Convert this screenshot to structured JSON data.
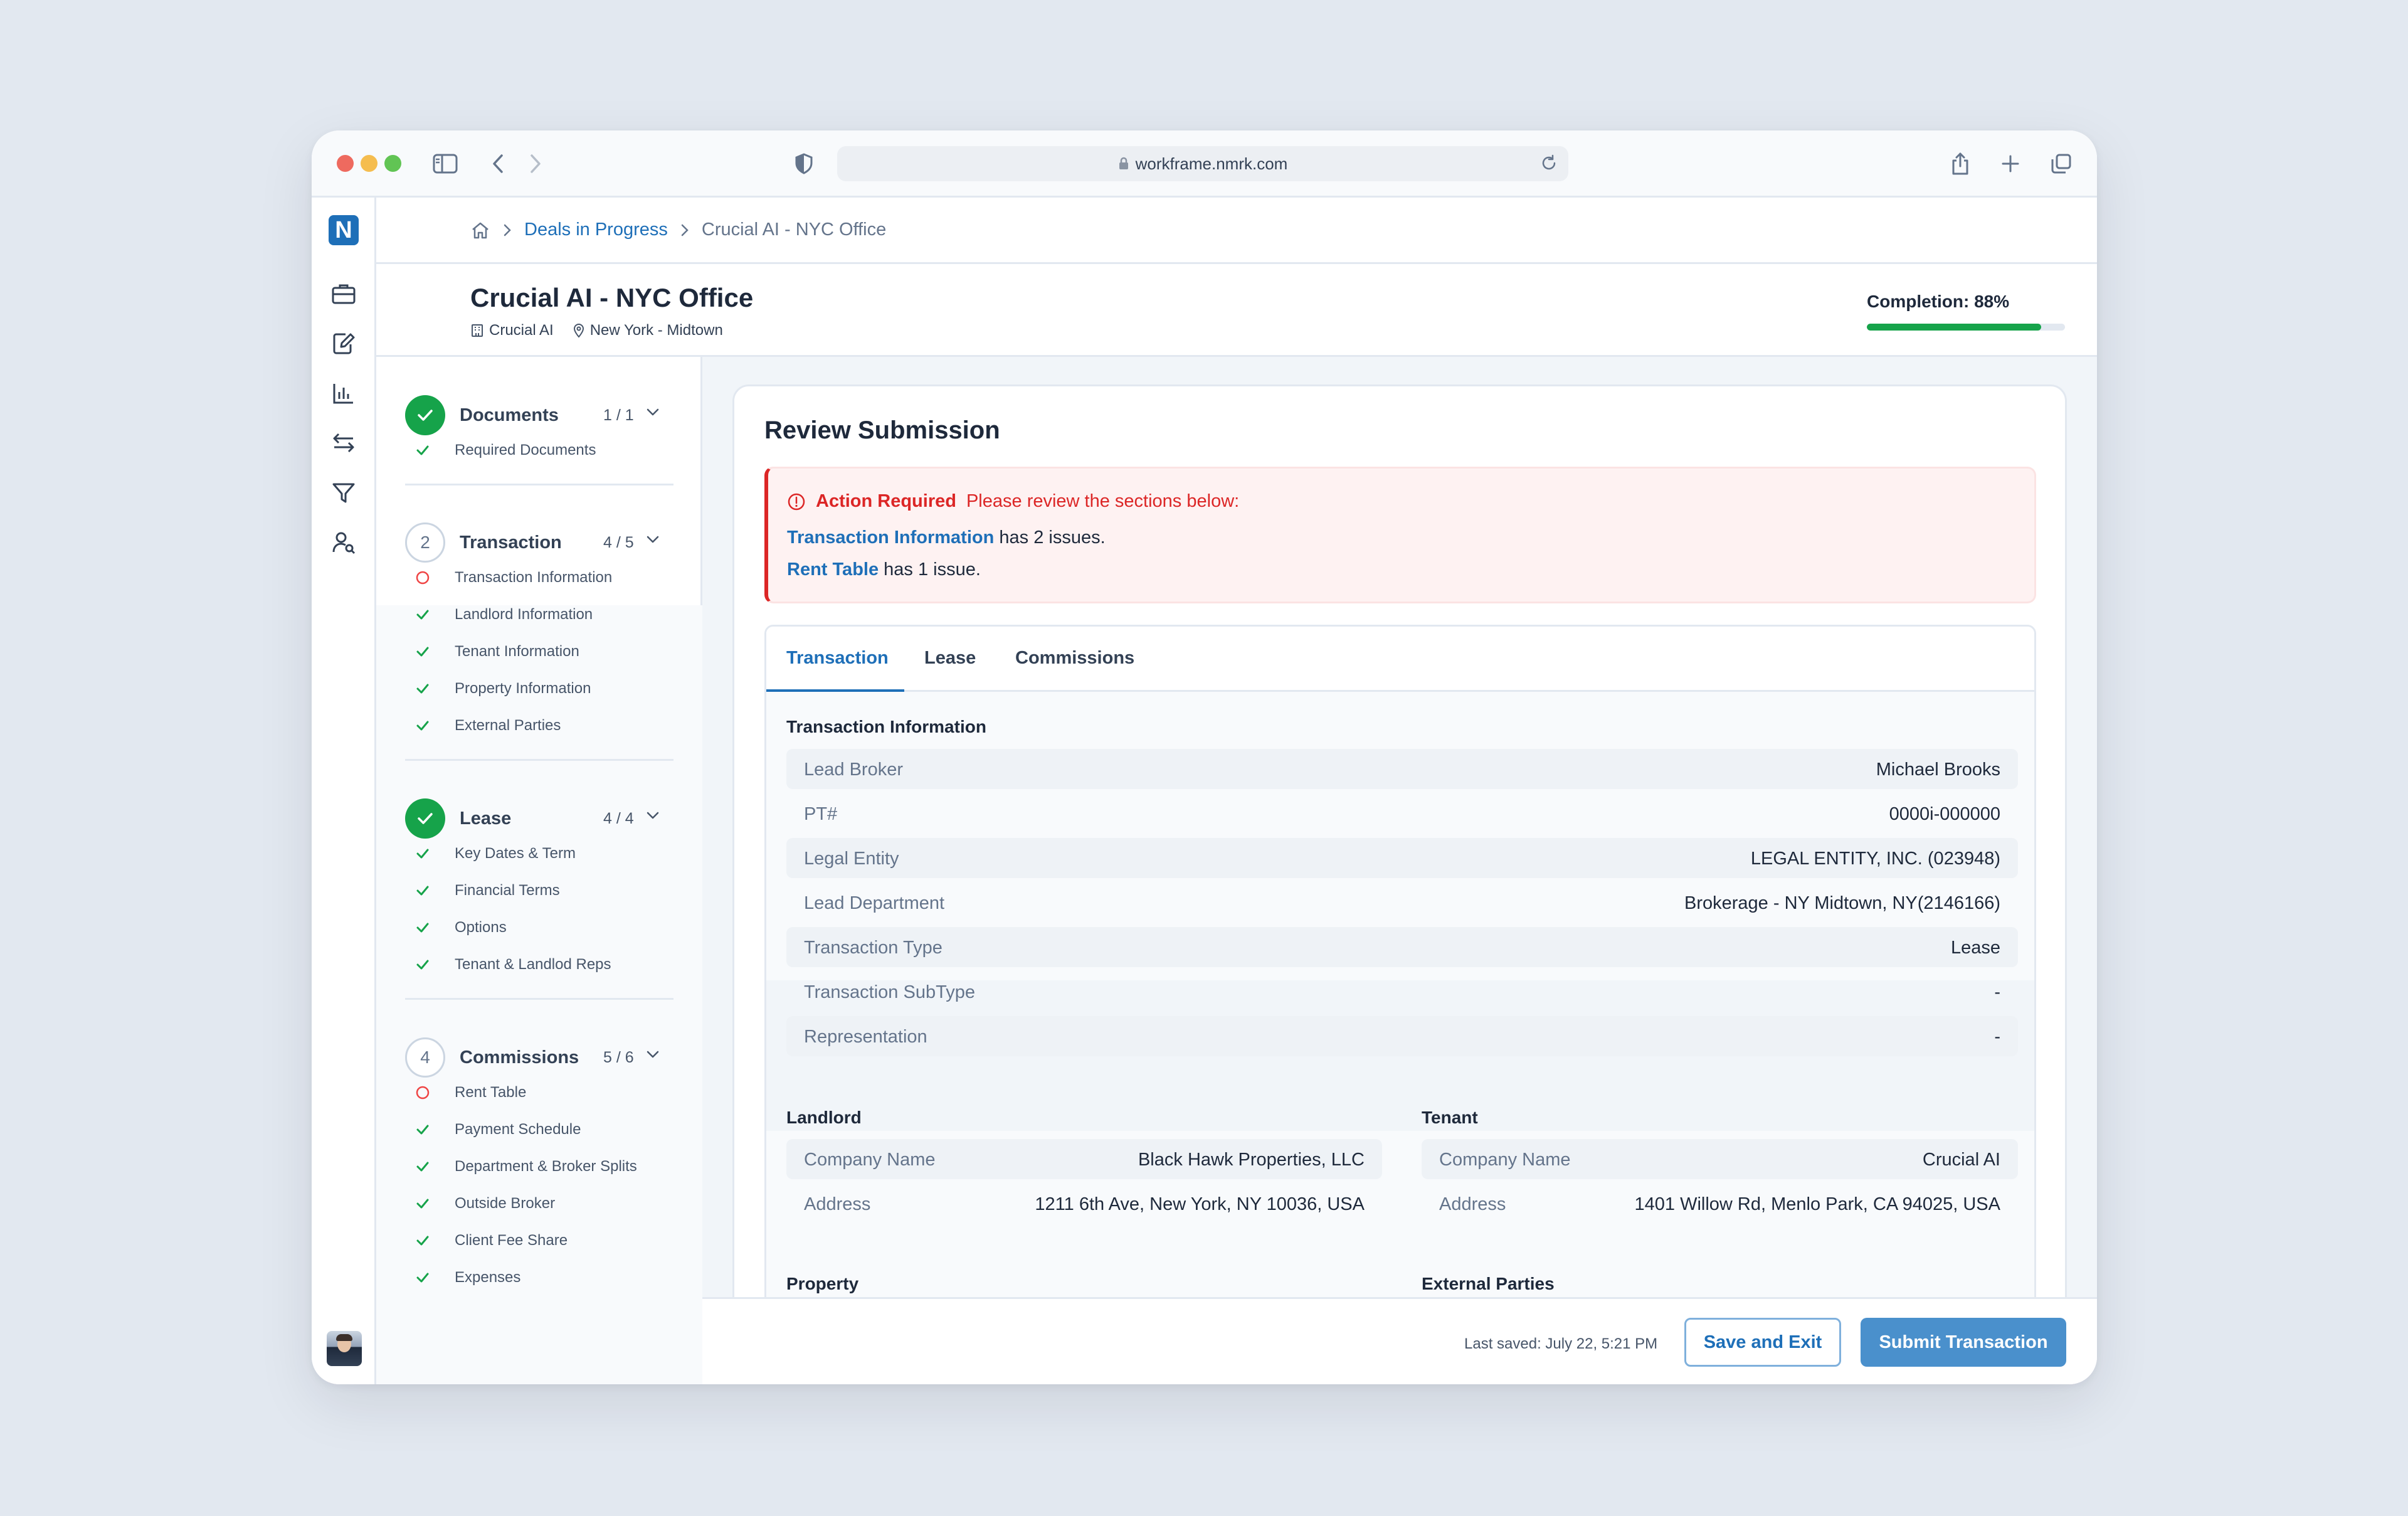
{
  "browser": {
    "url": "workframe.nmrk.com"
  },
  "app": {
    "logo_letter": "N"
  },
  "breadcrumb": {
    "parent": "Deals in Progress",
    "current": "Crucial AI - NYC Office"
  },
  "deal": {
    "title": "Crucial AI - NYC Office",
    "company": "Crucial AI",
    "location": "New York - Midtown",
    "completion_label": "Completion: 88%",
    "completion_percent": 88
  },
  "steps": [
    {
      "marker": "",
      "title": "Documents",
      "count": "1 / 1",
      "status": "done",
      "items": [
        {
          "label": "Required Documents",
          "status": "done"
        }
      ]
    },
    {
      "marker": "2",
      "title": "Transaction",
      "count": "4 / 5",
      "status": "pending",
      "items": [
        {
          "label": "Transaction Information",
          "status": "issue"
        },
        {
          "label": "Landlord Information",
          "status": "done"
        },
        {
          "label": "Tenant Information",
          "status": "done"
        },
        {
          "label": "Property Information",
          "status": "done"
        },
        {
          "label": "External Parties",
          "status": "done"
        }
      ]
    },
    {
      "marker": "",
      "title": "Lease",
      "count": "4 / 4",
      "status": "done",
      "items": [
        {
          "label": "Key Dates & Term",
          "status": "done"
        },
        {
          "label": "Financial Terms",
          "status": "done"
        },
        {
          "label": "Options",
          "status": "done"
        },
        {
          "label": "Tenant & Landlod Reps",
          "status": "done"
        }
      ]
    },
    {
      "marker": "4",
      "title": "Commissions",
      "count": "5 / 6",
      "status": "pending",
      "items": [
        {
          "label": "Rent Table",
          "status": "issue"
        },
        {
          "label": "Payment Schedule",
          "status": "done"
        },
        {
          "label": "Department & Broker Splits",
          "status": "done"
        },
        {
          "label": "Outside Broker",
          "status": "done"
        },
        {
          "label": "Client Fee Share",
          "status": "done"
        },
        {
          "label": "Expenses",
          "status": "done"
        }
      ]
    }
  ],
  "review": {
    "title": "Review Submission",
    "alert": {
      "heading": "Action Required",
      "message": "Please review the sections below:",
      "issues": [
        {
          "link": "Transaction Information",
          "text": " has 2 issues."
        },
        {
          "link": "Rent Table",
          "text": " has 1 issue."
        }
      ]
    },
    "tabs": [
      "Transaction",
      "Lease",
      "Commissions"
    ],
    "active_tab": "Transaction",
    "transaction_info": {
      "title": "Transaction Information",
      "rows": [
        {
          "label": "Lead Broker",
          "value": "Michael Brooks"
        },
        {
          "label": "PT#",
          "value": "0000i-000000"
        },
        {
          "label": "Legal Entity",
          "value": "LEGAL ENTITY, INC. (023948)"
        },
        {
          "label": "Lead Department",
          "value": "Brokerage - NY Midtown, NY(2146166)"
        },
        {
          "label": "Transaction Type",
          "value": "Lease"
        },
        {
          "label": "Transaction SubType",
          "value": "-"
        },
        {
          "label": "Representation",
          "value": "-"
        }
      ]
    },
    "landlord": {
      "title": "Landlord",
      "rows": [
        {
          "label": "Company Name",
          "value": "Black Hawk Properties, LLC"
        },
        {
          "label": "Address",
          "value": "1211 6th Ave, New York, NY 10036, USA"
        }
      ]
    },
    "tenant": {
      "title": "Tenant",
      "rows": [
        {
          "label": "Company Name",
          "value": "Crucial AI"
        },
        {
          "label": "Address",
          "value": "1401 Willow Rd, Menlo Park, CA 94025, USA"
        }
      ]
    },
    "property_title": "Property",
    "external_parties_title": "External Parties"
  },
  "footer": {
    "last_saved": "Last saved: July 22, 5:21 PM",
    "save_exit": "Save and Exit",
    "submit": "Submit Transaction"
  },
  "colors": {
    "brand": "#1e6fb8",
    "success": "#16a34a",
    "danger": "#dc2626",
    "primary_button": "#4a90cc"
  }
}
